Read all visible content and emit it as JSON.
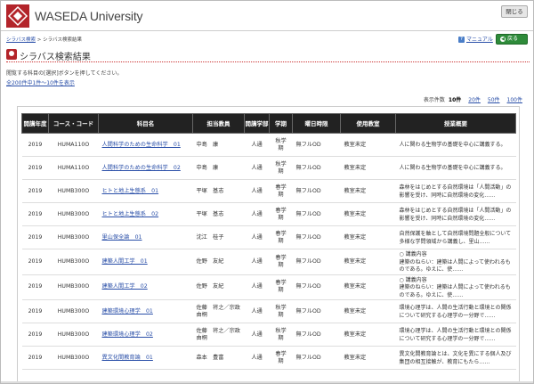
{
  "header": {
    "university_name": "WASEDA University",
    "close_label": "閉じる"
  },
  "breadcrumb": {
    "home": "シラバス検索",
    "separator": ">",
    "current": "シラバス検索結果"
  },
  "toolbar": {
    "manual_label": "マニュアル",
    "back_label": "戻る"
  },
  "page": {
    "title": "シラバス検索結果",
    "instruction": "閲覧する科目の[選択]ボタンを押してください。",
    "result_count": "全200件中1件～10件を表示"
  },
  "page_size": {
    "label": "表示件数",
    "current": "10件",
    "options": [
      "20件",
      "50件",
      "100件"
    ]
  },
  "table": {
    "headers": [
      "開講年度",
      "コース・コード",
      "科目名",
      "担当教員",
      "開講学部",
      "学期",
      "曜日時限",
      "使用教室",
      "授業概要"
    ],
    "rows": [
      {
        "year": "2019",
        "code": "HUMA110O",
        "subject": "人間科学のための生命科学　01",
        "teacher": "中島　康",
        "faculty": "人通",
        "term": "秋学期",
        "period": "無フルOD",
        "room": "教室未定",
        "summary": "人に関わる生物学の基礎を中心に講義する。"
      },
      {
        "year": "2019",
        "code": "HUMA110O",
        "subject": "人間科学のための生命科学　02",
        "teacher": "中島　康",
        "faculty": "人通",
        "term": "秋学期",
        "period": "無フルOD",
        "room": "教室未定",
        "summary": "人に関わる生物学の基礎を中心に講義する。"
      },
      {
        "year": "2019",
        "code": "HUMB300O",
        "subject": "ヒトと地上生態系　01",
        "teacher": "平塚　基志",
        "faculty": "人通",
        "term": "春学期",
        "period": "無フルOD",
        "room": "教室未定",
        "summary": "森林をはじめとする自然環境は「人間活動」の影響を受け、同時に自然環境の変化……"
      },
      {
        "year": "2019",
        "code": "HUMB300O",
        "subject": "ヒトと地上生態系　02",
        "teacher": "平塚　基志",
        "faculty": "人通",
        "term": "春学期",
        "period": "無フルOD",
        "room": "教室未定",
        "summary": "森林をはじめとする自然環境は「人間活動」の影響を受け、同時に自然環境の変化……"
      },
      {
        "year": "2019",
        "code": "HUMB300O",
        "subject": "里山保全論　01",
        "teacher": "沈江　桂子",
        "faculty": "人通",
        "term": "春学期",
        "period": "無フルOD",
        "room": "教室未定",
        "summary": "自然保護を軸として自然環境問題全般について多様な学問領域から講義し、里山……"
      },
      {
        "year": "2019",
        "code": "HUMB300O",
        "subject": "建築人間工学　01",
        "teacher": "佐野　友紀",
        "faculty": "人通",
        "term": "春学期",
        "period": "無フルOD",
        "room": "教室未定",
        "summary": "○ 講義内容\n建築のねらい：建築は人間によって使われるものである。ゆえに、使……"
      },
      {
        "year": "2019",
        "code": "HUMB300O",
        "subject": "建築人間工学　02",
        "teacher": "佐野　友紀",
        "faculty": "人通",
        "term": "春学期",
        "period": "無フルOD",
        "room": "教室未定",
        "summary": "○ 講義内容\n建築のねらい：建築は人間によって使われるものである。ゆえに、使……"
      },
      {
        "year": "2019",
        "code": "HUMB300O",
        "subject": "建築環境心理学　01",
        "teacher": "佐藤　将之／宗政　由桐",
        "faculty": "人通",
        "term": "秋学期",
        "period": "無フルOD",
        "room": "教室未定",
        "summary": "環境心理学は、人間の生活行動と環境との関係について研究する心理学の一分野で……"
      },
      {
        "year": "2019",
        "code": "HUMB300O",
        "subject": "建築環境心理学　02",
        "teacher": "佐藤　将之／宗政　由桐",
        "faculty": "人通",
        "term": "秋学期",
        "period": "無フルOD",
        "room": "教室未定",
        "summary": "環境心理学は、人間の生活行動と環境との関係について研究する心理学の一分野で……"
      },
      {
        "year": "2019",
        "code": "HUMB300O",
        "subject": "異文化間教育論　01",
        "teacher": "森本　豊富",
        "faculty": "人通",
        "term": "春学期",
        "period": "無フルOD",
        "room": "教室未定",
        "summary": "異文化間教育論とは、文化を異にする個人及び集団の相互接触が、教育にもたら……"
      }
    ]
  },
  "colors": {
    "brand": "#b3242a",
    "link": "#2a4fa8",
    "header_bg": "#222222",
    "back_button": "#2e8b3a"
  }
}
